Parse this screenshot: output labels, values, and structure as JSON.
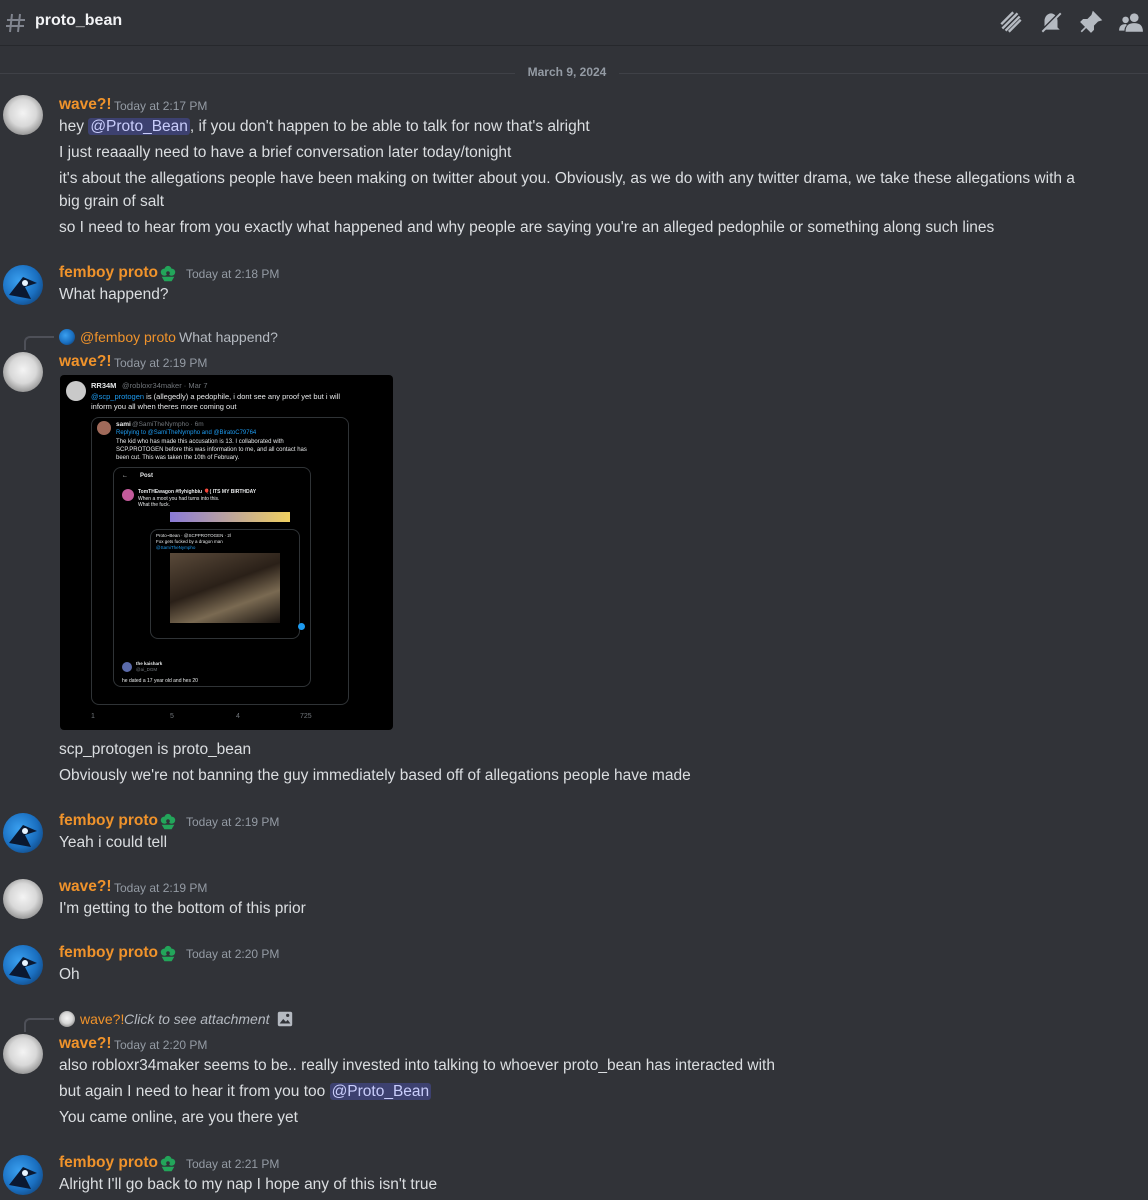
{
  "channel": {
    "name": "proto_bean"
  },
  "header_icons": [
    "threads-icon",
    "mute-bell-icon",
    "pin-icon",
    "members-icon"
  ],
  "date_divider": "March 9, 2024",
  "messages": [
    {
      "author": "wave?!",
      "timestamp": "Today at 2:17 PM",
      "lines": {
        "l1_pre": "hey ",
        "l1_mention": "@Proto_Bean",
        "l1_post": ", if you don't happen to be able to talk for now that's alright",
        "l2": "I just reaaally need to have a brief conversation later today/tonight",
        "l3a": "it's about the allegations people have been making on twitter about you. Obviously, as we do with any twitter drama, we take these allegations with a",
        "l3b": "big grain of salt",
        "l4": "so I need to hear from you exactly what happened and why people are saying you're an alleged pedophile or something along such lines"
      }
    },
    {
      "author": "femboy proto",
      "timestamp": "Today at 2:18 PM",
      "text": "What happend?"
    },
    {
      "reply_to": {
        "name": "@femboy proto",
        "text": "What happend?"
      },
      "author": "wave?!",
      "timestamp": "Today at 2:19 PM",
      "tweet": {
        "author": "RR34M",
        "handle": "@robloxr34maker · Mar 7",
        "mention": "@scp_protogen",
        "body1": " is (allegedly) a pedophile, i dont see any proof yet but i will",
        "body2": "inform you all when theres more coming out",
        "quote_author": "sami",
        "quote_handle": "@SamiTheNympho · 6m",
        "quote_reply": "Replying to @SamiTheNympho and @BiratoC79764",
        "quote_body1": "The kid who has made this accusation is 13. I collaborated with",
        "quote_body2": "SCP.PROTOGEN before this was information to me, and all contact has",
        "quote_body3": "been cut. This was taken the 10th of February.",
        "post_label": "Post",
        "inner_author": "TomTHEwagon #flyhighbiu 🎈( ITS MY BIRTHDAY",
        "inner_body1": "When a moot you had turns into this.",
        "inner_body2": "What the fuck.",
        "inner_quote": "Proto~Bean · @SCPPROTOGEN · 2l",
        "inner_quote_body": "Fox gets fucked by a dragon man",
        "inner_quote_tag": "@SamiTheNympho",
        "reply_author": "the kaishark",
        "reply_handle": "@ai_DGM",
        "reply_body": "he dated a 17 year old and hes 20",
        "stats": [
          "1",
          "5",
          "4",
          "725"
        ]
      },
      "lines": {
        "l1": "scp_protogen is proto_bean",
        "l2": "Obviously we're not banning the guy immediately based off of allegations people have made"
      }
    },
    {
      "author": "femboy proto",
      "timestamp": "Today at 2:19 PM",
      "text": "Yeah i could tell"
    },
    {
      "author": "wave?!",
      "timestamp": "Today at 2:19 PM",
      "text": "I'm getting to the bottom of this prior"
    },
    {
      "author": "femboy proto",
      "timestamp": "Today at 2:20 PM",
      "text": "Oh"
    },
    {
      "reply_to": {
        "name": "wave?!",
        "text": "Click to see attachment"
      },
      "author": "wave?!",
      "timestamp": "Today at 2:20 PM",
      "lines": {
        "l1": "also robloxr34maker seems to be.. really invested into talking to whoever proto_bean has interacted with",
        "l2_pre": "but again I need to hear it from you too ",
        "l2_mention": "@Proto_Bean",
        "l3": "You came online, are you there yet"
      }
    },
    {
      "author": "femboy proto",
      "timestamp": "Today at 2:21 PM",
      "text": "Alright I'll go back to my nap I hope any of this isn't true"
    }
  ],
  "colors": {
    "background": "#313338",
    "username": "#f0932b",
    "mention_bg": "#5865f2",
    "text": "#dbdee1",
    "muted": "#949ba4",
    "badge_green": "#23a55a"
  }
}
